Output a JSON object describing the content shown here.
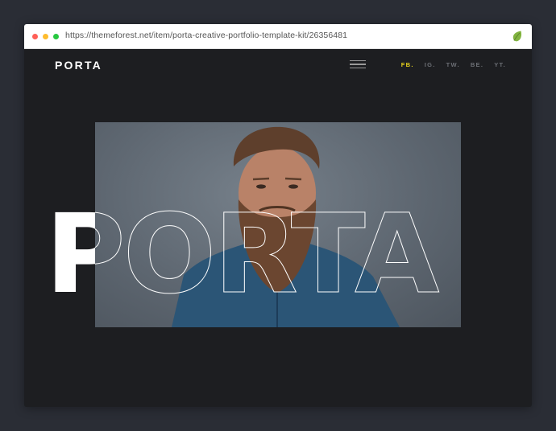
{
  "browser": {
    "url": "https://themeforest.net/item/porta-creative-portfolio-template-kit/26356481",
    "extension_icon": "envato-leaf-icon"
  },
  "site": {
    "logo": "PORTA",
    "menu_icon": "hamburger-menu-icon",
    "social": [
      {
        "label": "FB.",
        "active": true
      },
      {
        "label": "IG.",
        "active": false
      },
      {
        "label": "TW.",
        "active": false
      },
      {
        "label": "BE.",
        "active": false
      },
      {
        "label": "YT.",
        "active": false
      }
    ],
    "hero_title": "PORTA"
  },
  "colors": {
    "background": "#1d1e21",
    "accent": "#e8d21c",
    "nav_muted": "#6c6f75"
  }
}
